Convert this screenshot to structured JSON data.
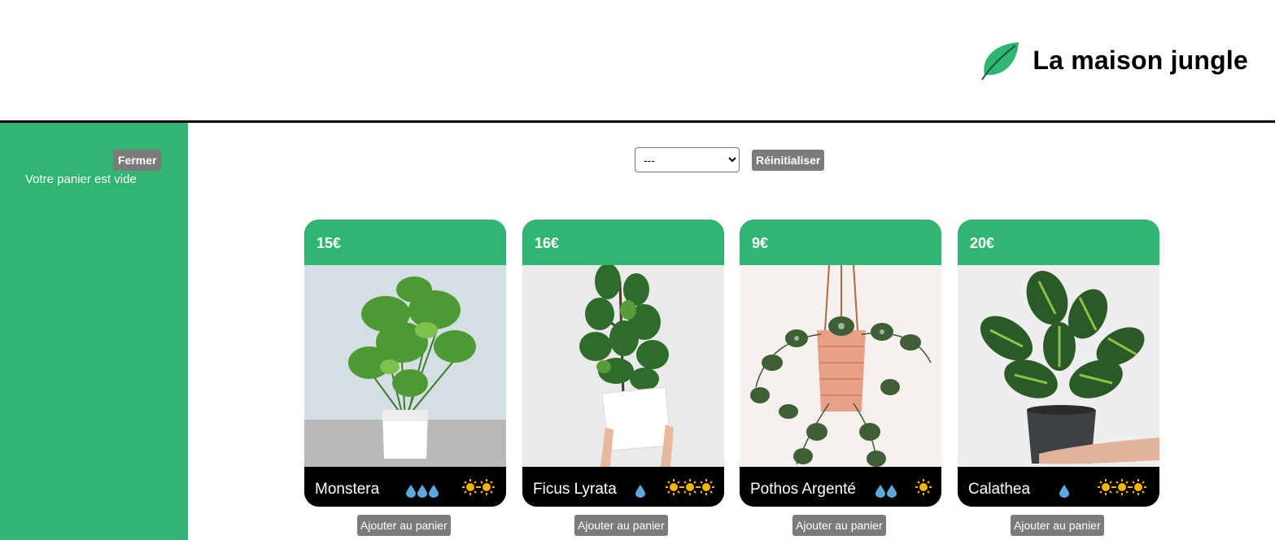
{
  "header": {
    "title": "La maison jungle",
    "logo_icon": "leaf-icon",
    "accent": "#31b572"
  },
  "cart": {
    "close_label": "Fermer",
    "empty_text": "Votre panier est vide"
  },
  "filters": {
    "category_selected": "---",
    "reset_label": "Réinitialiser"
  },
  "plants": [
    {
      "price": "15€",
      "name": "Monstera",
      "water_level": 3,
      "light_level": 2,
      "add_label": "Ajouter au panier"
    },
    {
      "price": "16€",
      "name": "Ficus Lyrata",
      "water_level": 1,
      "light_level": 3,
      "add_label": "Ajouter au panier"
    },
    {
      "price": "9€",
      "name": "Pothos Argenté",
      "water_level": 2,
      "light_level": 1,
      "add_label": "Ajouter au panier"
    },
    {
      "price": "20€",
      "name": "Calathea",
      "water_level": 1,
      "light_level": 3,
      "add_label": "Ajouter au panier"
    }
  ],
  "icons": {
    "water": "water-drop-icon",
    "light": "sun-icon"
  },
  "colors": {
    "water": "#5fa8dd",
    "sun": "#f5b400"
  }
}
